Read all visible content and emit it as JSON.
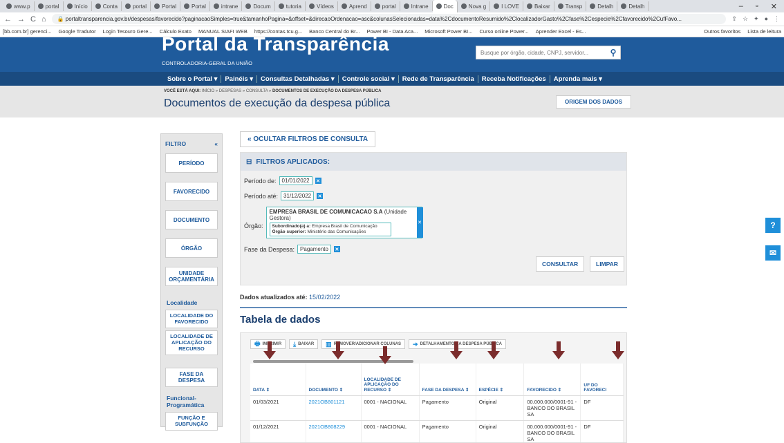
{
  "browser": {
    "tabs": [
      "www.p",
      "portal",
      "Início",
      "Conta",
      "portal",
      "Portal",
      "Portal",
      "intrane",
      "Docum",
      "tutoria",
      "Vídeos",
      "Aprend",
      "portal",
      "Intrane",
      "Doc",
      "Nova g",
      "I LOVE",
      "Baixar",
      "Transp",
      "Detalh",
      "Detalh"
    ],
    "active_tab": "Doc",
    "url": "portaltransparencia.gov.br/despesas/favorecido?paginacaoSimples=true&tamanhoPagina=&offset=&direcaoOrdenacao=asc&colunasSelecionadas=data%2CdocumentoResumido%2ClocalizadorGasto%2Cfase%2Cespecie%2Cfavorecido%2CufFavo...",
    "bookmarks": [
      "[bb.com.br] gerenci...",
      "Google Tradutor",
      "Login Tesouro Gere...",
      "Cálculo Exato",
      "MANUAL SIAFI WEB",
      "https://contas.tcu.g...",
      "Banco Central do Br...",
      "Power BI - Data Aca...",
      "Microsoft Power BI...",
      "Curso online Power...",
      "Aprender Excel - Es..."
    ],
    "bookmarks_right": [
      "Outros favoritos",
      "Lista de leitura"
    ]
  },
  "header": {
    "title": "Portal da Transparência",
    "subtitle": "CONTROLADORIA-GERAL DA UNIÃO",
    "search_placeholder": "Busque por órgão, cidade, CNPJ, servidor..."
  },
  "nav": [
    "Sobre o Portal ▾",
    "Painéis ▾",
    "Consultas Detalhadas ▾",
    "Controle social ▾",
    "Rede de Transparência",
    "Receba Notificações",
    "Aprenda mais ▾"
  ],
  "breadcrumb": {
    "prefix": "VOCÊ ESTÁ AQUI:",
    "path": "INÍCIO » DESPESAS » CONSULTA » ",
    "current": "DOCUMENTOS DE EXECUÇÃO DA DESPESA PÚBLICA"
  },
  "page_title": "Documentos de execução da despesa pública",
  "origem_label": "ORIGEM DOS DADOS",
  "sidebar": {
    "title": "FILTRO",
    "collapse": "«",
    "buttons": [
      "PERÍODO",
      "FAVORECIDO",
      "DOCUMENTO",
      "ÓRGÃO",
      "UNIDADE ORÇAMENTÁRIA"
    ],
    "localidade_title": "Localidade",
    "localidade_buttons": [
      "LOCALIDADE DO FAVORECIDO",
      "LOCALIDADE DE APLICAÇÃO DO RECURSO"
    ],
    "fase": "FASE DA DESPESA",
    "funcional_title": "Funcional-Programática",
    "funcao": "FUNÇÃO E SUBFUNÇÃO"
  },
  "filters": {
    "toggle_label": "« OCULTAR FILTROS DE CONSULTA",
    "applied_title": "FILTROS APLICADOS:",
    "periodo_de_label": "Período de:",
    "periodo_de": "01/01/2022",
    "periodo_ate_label": "Período até:",
    "periodo_ate": "31/12/2022",
    "orgao_label": "Órgão:",
    "orgao_name": "EMPRESA BRASIL DE COMUNICACAO S.A",
    "orgao_type": "(Unidade Gestora)",
    "subordinado_label": "Subordinado(a) a:",
    "subordinado": "Empresa Brasil de Comunicação",
    "superior_label": "Órgão superior:",
    "superior": "Ministério das Comunicações",
    "fase_label": "Fase da Despesa:",
    "fase": "Pagamento",
    "consultar": "CONSULTAR",
    "limpar": "LIMPAR"
  },
  "updated": {
    "label": "Dados atualizados até:",
    "date": "15/02/2022"
  },
  "table_title": "Tabela de dados",
  "toolbar": [
    "IMPRIMIR",
    "BAIXAR",
    "REMOVER/ADICIONAR COLUNAS",
    "DETALHAMENTO DA DESPESA PÚBLICA"
  ],
  "table": {
    "headers": [
      "DATA ⇕",
      "DOCUMENTO ⇕",
      "LOCALIDADE DE APLICAÇÃO DO RECURSO ⇕",
      "FASE DA DESPESA ⇕",
      "ESPÉCIE ⇕",
      "FAVORECIDO ⇕",
      "UF DO FAVORECI"
    ],
    "rows": [
      [
        "01/03/2021",
        "2021OB801121",
        "0001 - NACIONAL",
        "Pagamento",
        "Original",
        "00.000.000/0001-91 - BANCO DO BRASIL SA",
        "DF"
      ],
      [
        "01/12/2021",
        "2021OB808229",
        "0001 - NACIONAL",
        "Pagamento",
        "Original",
        "00.000.000/0001-91 - BANCO DO BRASIL SA",
        "DF"
      ]
    ]
  },
  "colors": {
    "brand": "#1f5b9c",
    "arrow": "#7b2c2c",
    "accent": "#1f8fd9"
  }
}
